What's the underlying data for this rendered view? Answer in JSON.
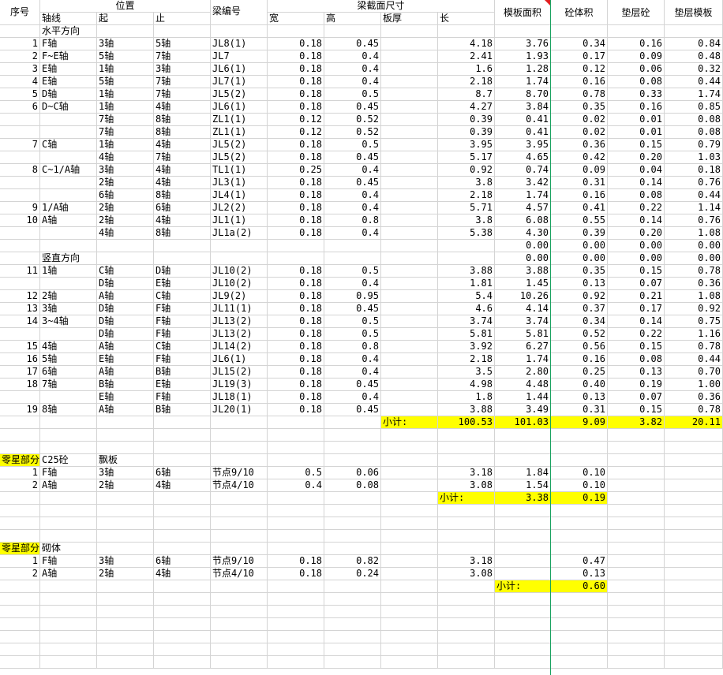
{
  "header": {
    "seq": "序号",
    "position": "位置",
    "axis": "轴线",
    "from": "起",
    "to": "止",
    "beam_no": "梁编号",
    "section": "梁截面尺寸",
    "width": "宽",
    "height": "高",
    "slab": "板厚",
    "length": "长",
    "formwork_area": "模板面积",
    "concrete_volume": "砼体积",
    "cushion_concrete": "垫层砼",
    "cushion_formwork": "垫层模板"
  },
  "rows": [
    {
      "row": 2,
      "cells": {
        "axis": "水平方向"
      }
    },
    {
      "row": 3,
      "cells": {
        "seq": "1",
        "axis": "F轴",
        "from": "3轴",
        "to": "5轴",
        "beam": "JL8(1)",
        "w": "0.18",
        "h": "0.45",
        "len": "4.18",
        "area": "3.76",
        "vol": "0.34",
        "cc": "0.16",
        "cf": "0.84"
      }
    },
    {
      "row": 4,
      "cells": {
        "seq": "2",
        "axis": "F~E轴",
        "from": "5轴",
        "to": "7轴",
        "beam": "JL7",
        "w": "0.18",
        "h": "0.4",
        "len": "2.41",
        "area": "1.93",
        "vol": "0.17",
        "cc": "0.09",
        "cf": "0.48"
      }
    },
    {
      "row": 5,
      "cells": {
        "seq": "3",
        "axis": "E轴",
        "from": "1轴",
        "to": "3轴",
        "beam": "JL6(1)",
        "w": "0.18",
        "h": "0.4",
        "len": "1.6",
        "area": "1.28",
        "vol": "0.12",
        "cc": "0.06",
        "cf": "0.32"
      }
    },
    {
      "row": 6,
      "cells": {
        "seq": "4",
        "axis": "E轴",
        "from": "5轴",
        "to": "7轴",
        "beam": "JL7(1)",
        "w": "0.18",
        "h": "0.4",
        "len": "2.18",
        "area": "1.74",
        "vol": "0.16",
        "cc": "0.08",
        "cf": "0.44"
      }
    },
    {
      "row": 7,
      "cells": {
        "seq": "5",
        "axis": "D轴",
        "from": "1轴",
        "to": "7轴",
        "beam": "JL5(2)",
        "w": "0.18",
        "h": "0.5",
        "len": "8.7",
        "area": "8.70",
        "vol": "0.78",
        "cc": "0.33",
        "cf": "1.74"
      }
    },
    {
      "row": 8,
      "cells": {
        "seq": "6",
        "axis": "D~C轴",
        "from": "1轴",
        "to": "4轴",
        "beam": "JL6(1)",
        "w": "0.18",
        "h": "0.45",
        "len": "4.27",
        "area": "3.84",
        "vol": "0.35",
        "cc": "0.16",
        "cf": "0.85"
      }
    },
    {
      "row": 9,
      "cells": {
        "from": "7轴",
        "to": "8轴",
        "beam": "ZL1(1)",
        "w": "0.12",
        "h": "0.52",
        "len": "0.39",
        "area": "0.41",
        "vol": "0.02",
        "cc": "0.01",
        "cf": "0.08"
      }
    },
    {
      "row": 10,
      "cells": {
        "from": "7轴",
        "to": "8轴",
        "beam": "ZL1(1)",
        "w": "0.12",
        "h": "0.52",
        "len": "0.39",
        "area": "0.41",
        "vol": "0.02",
        "cc": "0.01",
        "cf": "0.08"
      }
    },
    {
      "row": 11,
      "cells": {
        "seq": "7",
        "axis": "C轴",
        "from": "1轴",
        "to": "4轴",
        "beam": "JL5(2)",
        "w": "0.18",
        "h": "0.5",
        "len": "3.95",
        "area": "3.95",
        "vol": "0.36",
        "cc": "0.15",
        "cf": "0.79"
      }
    },
    {
      "row": 12,
      "cells": {
        "from": "4轴",
        "to": "7轴",
        "beam": "JL5(2)",
        "w": "0.18",
        "h": "0.45",
        "len": "5.17",
        "area": "4.65",
        "vol": "0.42",
        "cc": "0.20",
        "cf": "1.03"
      }
    },
    {
      "row": 13,
      "cells": {
        "seq": "8",
        "axis": "C~1/A轴",
        "from": "3轴",
        "to": "4轴",
        "beam": "TL1(1)",
        "w": "0.25",
        "h": "0.4",
        "len": "0.92",
        "area": "0.74",
        "vol": "0.09",
        "cc": "0.04",
        "cf": "0.18"
      }
    },
    {
      "row": 14,
      "cells": {
        "from": "2轴",
        "to": "4轴",
        "beam": "JL3(1)",
        "w": "0.18",
        "h": "0.45",
        "len": "3.8",
        "area": "3.42",
        "vol": "0.31",
        "cc": "0.14",
        "cf": "0.76"
      }
    },
    {
      "row": 15,
      "cells": {
        "from": "6轴",
        "to": "8轴",
        "beam": "JL4(1)",
        "w": "0.18",
        "h": "0.4",
        "len": "2.18",
        "area": "1.74",
        "vol": "0.16",
        "cc": "0.08",
        "cf": "0.44"
      }
    },
    {
      "row": 16,
      "cells": {
        "seq": "9",
        "axis": "1/A轴",
        "from": "2轴",
        "to": "6轴",
        "beam": "JL2(2)",
        "w": "0.18",
        "h": "0.4",
        "len": "5.71",
        "area": "4.57",
        "vol": "0.41",
        "cc": "0.22",
        "cf": "1.14"
      }
    },
    {
      "row": 17,
      "cells": {
        "seq": "10",
        "axis": "A轴",
        "from": "2轴",
        "to": "4轴",
        "beam": "JL1(1)",
        "w": "0.18",
        "h": "0.8",
        "len": "3.8",
        "area": "6.08",
        "vol": "0.55",
        "cc": "0.14",
        "cf": "0.76"
      }
    },
    {
      "row": 18,
      "cells": {
        "from": "4轴",
        "to": "8轴",
        "beam": "JL1a(2)",
        "w": "0.18",
        "h": "0.4",
        "len": "5.38",
        "area": "4.30",
        "vol": "0.39",
        "cc": "0.20",
        "cf": "1.08"
      }
    },
    {
      "row": 19,
      "cells": {
        "area": "0.00",
        "vol": "0.00",
        "cc": "0.00",
        "cf": "0.00"
      }
    },
    {
      "row": 20,
      "cells": {
        "axis": "竖直方向",
        "area": "0.00",
        "vol": "0.00",
        "cc": "0.00",
        "cf": "0.00"
      }
    },
    {
      "row": 21,
      "cells": {
        "seq": "11",
        "axis": "1轴",
        "from": "C轴",
        "to": "D轴",
        "beam": "JL10(2)",
        "w": "0.18",
        "h": "0.5",
        "len": "3.88",
        "area": "3.88",
        "vol": "0.35",
        "cc": "0.15",
        "cf": "0.78"
      }
    },
    {
      "row": 22,
      "cells": {
        "from": "D轴",
        "to": "E轴",
        "beam": "JL10(2)",
        "w": "0.18",
        "h": "0.4",
        "len": "1.81",
        "area": "1.45",
        "vol": "0.13",
        "cc": "0.07",
        "cf": "0.36"
      }
    },
    {
      "row": 23,
      "cells": {
        "seq": "12",
        "axis": "2轴",
        "from": "A轴",
        "to": "C轴",
        "beam": "JL9(2)",
        "w": "0.18",
        "h": "0.95",
        "len": "5.4",
        "area": "10.26",
        "vol": "0.92",
        "cc": "0.21",
        "cf": "1.08"
      }
    },
    {
      "row": 24,
      "cells": {
        "seq": "13",
        "axis": "3轴",
        "from": "D轴",
        "to": "F轴",
        "beam": "JL11(1)",
        "w": "0.18",
        "h": "0.45",
        "len": "4.6",
        "area": "4.14",
        "vol": "0.37",
        "cc": "0.17",
        "cf": "0.92"
      }
    },
    {
      "row": 25,
      "cells": {
        "seq": "14",
        "axis": "3~4轴",
        "from": "D轴",
        "to": "F轴",
        "beam": "JL13(2)",
        "w": "0.18",
        "h": "0.5",
        "len": "3.74",
        "area": "3.74",
        "vol": "0.34",
        "cc": "0.14",
        "cf": "0.75"
      }
    },
    {
      "row": 26,
      "cells": {
        "from": "D轴",
        "to": "F轴",
        "beam": "JL13(2)",
        "w": "0.18",
        "h": "0.5",
        "len": "5.81",
        "area": "5.81",
        "vol": "0.52",
        "cc": "0.22",
        "cf": "1.16"
      }
    },
    {
      "row": 27,
      "cells": {
        "seq": "15",
        "axis": "4轴",
        "from": "A轴",
        "to": "C轴",
        "beam": "JL14(2)",
        "w": "0.18",
        "h": "0.8",
        "len": "3.92",
        "area": "6.27",
        "vol": "0.56",
        "cc": "0.15",
        "cf": "0.78"
      }
    },
    {
      "row": 28,
      "cells": {
        "seq": "16",
        "axis": "5轴",
        "from": "E轴",
        "to": "F轴",
        "beam": "JL6(1)",
        "w": "0.18",
        "h": "0.4",
        "len": "2.18",
        "area": "1.74",
        "vol": "0.16",
        "cc": "0.08",
        "cf": "0.44"
      }
    },
    {
      "row": 29,
      "cells": {
        "seq": "17",
        "axis": "6轴",
        "from": "A轴",
        "to": "B轴",
        "beam": "JL15(2)",
        "w": "0.18",
        "h": "0.4",
        "len": "3.5",
        "area": "2.80",
        "vol": "0.25",
        "cc": "0.13",
        "cf": "0.70"
      }
    },
    {
      "row": 30,
      "cells": {
        "seq": "18",
        "axis": "7轴",
        "from": "B轴",
        "to": "E轴",
        "beam": "JL19(3)",
        "w": "0.18",
        "h": "0.45",
        "len": "4.98",
        "area": "4.48",
        "vol": "0.40",
        "cc": "0.19",
        "cf": "1.00"
      }
    },
    {
      "row": 31,
      "cells": {
        "from": "E轴",
        "to": "F轴",
        "beam": "JL18(1)",
        "w": "0.18",
        "h": "0.4",
        "len": "1.8",
        "area": "1.44",
        "vol": "0.13",
        "cc": "0.07",
        "cf": "0.36"
      }
    },
    {
      "row": 32,
      "cells": {
        "seq": "19",
        "axis": "8轴",
        "from": "A轴",
        "to": "B轴",
        "beam": "JL20(1)",
        "w": "0.18",
        "h": "0.45",
        "len": "3.88",
        "area": "3.49",
        "vol": "0.31",
        "cc": "0.15",
        "cf": "0.78"
      }
    },
    {
      "row": 33,
      "cells": {
        "slab": "小计:",
        "len": "100.53",
        "area": "101.03",
        "vol": "9.09",
        "cc": "3.82",
        "cf": "20.11"
      },
      "highlight": [
        "slab",
        "len",
        "area",
        "vol",
        "cc",
        "cf"
      ]
    },
    {
      "row": 36,
      "cells": {
        "seq": "零星部分",
        "axis": "C25砼",
        "from": "飘板"
      },
      "highlight": [
        "seq"
      ]
    },
    {
      "row": 37,
      "cells": {
        "seq": "1",
        "axis": "F轴",
        "from": "3轴",
        "to": "6轴",
        "beam": "节点9/10",
        "w": "0.5",
        "h": "0.06",
        "len": "3.18",
        "area": "1.84",
        "vol": "0.10"
      }
    },
    {
      "row": 38,
      "cells": {
        "seq": "2",
        "axis": "A轴",
        "from": "2轴",
        "to": "4轴",
        "beam": "节点4/10",
        "w": "0.4",
        "h": "0.08",
        "len": "3.08",
        "area": "1.54",
        "vol": "0.10"
      }
    },
    {
      "row": 39,
      "cells": {
        "len": "小计:",
        "area": "3.38",
        "vol": "0.19"
      },
      "highlight": [
        "len",
        "area",
        "vol"
      ]
    },
    {
      "row": 43,
      "cells": {
        "seq": "零星部分",
        "axis": "砌体"
      },
      "highlight": [
        "seq"
      ]
    },
    {
      "row": 44,
      "cells": {
        "seq": "1",
        "axis": "F轴",
        "from": "3轴",
        "to": "6轴",
        "beam": "节点9/10",
        "w": "0.18",
        "h": "0.82",
        "len": "3.18",
        "vol": "0.47"
      }
    },
    {
      "row": 45,
      "cells": {
        "seq": "2",
        "axis": "A轴",
        "from": "2轴",
        "to": "4轴",
        "beam": "节点4/10",
        "w": "0.18",
        "h": "0.24",
        "len": "3.08",
        "vol": "0.13"
      }
    },
    {
      "row": 46,
      "cells": {
        "area": "小计:",
        "vol": "0.60"
      },
      "highlight": [
        "area",
        "vol"
      ]
    }
  ],
  "colors": {
    "grid": "#d4d4d4",
    "highlight": "#ffff00",
    "freeze_line": "#1aa260",
    "comment_mark": "#e02020"
  }
}
